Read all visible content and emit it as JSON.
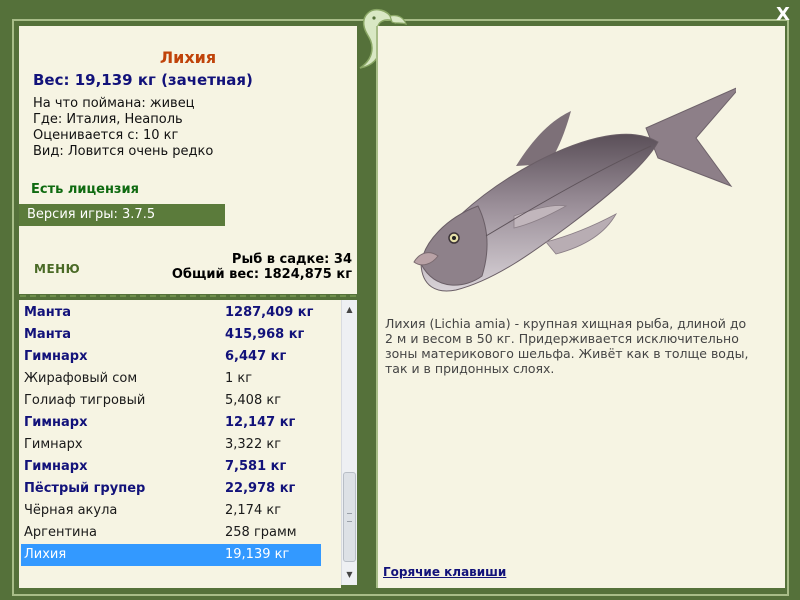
{
  "window": {
    "close_label": "X"
  },
  "fish": {
    "title": "Лихия",
    "weight_line": "Вес: 19,139 кг (зачетная)",
    "details": [
      "На что поймана: живец",
      "Где: Италия, Неаполь",
      "Оценивается с: 10 кг",
      "Вид: Ловится очень редко"
    ]
  },
  "license": "Есть лицензия",
  "version": "Версия игры: 3.7.5",
  "menu_label": "МЕНЮ",
  "stats": {
    "fish_in_keepnet": "Рыб в садке: 34",
    "total_weight": "Общий вес: 1824,875 кг"
  },
  "catch_list": [
    {
      "name": "Манта",
      "weight": "1287,409 кг",
      "trophy": true
    },
    {
      "name": "Манта",
      "weight": "415,968 кг",
      "trophy": true
    },
    {
      "name": "Гимнарх",
      "weight": "6,447 кг",
      "trophy": true
    },
    {
      "name": "Жирафовый сом",
      "weight": "1 кг",
      "trophy": false
    },
    {
      "name": "Голиаф тигровый",
      "weight": "5,408 кг",
      "trophy": false
    },
    {
      "name": "Гимнарх",
      "weight": "12,147 кг",
      "trophy": true
    },
    {
      "name": "Гимнарх",
      "weight": "3,322 кг",
      "trophy": false
    },
    {
      "name": "Гимнарх",
      "weight": "7,581 кг",
      "trophy": true
    },
    {
      "name": "Пёстрый групер",
      "weight": "22,978 кг",
      "trophy": true
    },
    {
      "name": "Чёрная акула",
      "weight": "2,174 кг",
      "trophy": false
    },
    {
      "name": "Аргентина",
      "weight": "258 грамм",
      "trophy": false
    },
    {
      "name": "Лихия",
      "weight": "19,139 кг",
      "trophy": false,
      "selected": true
    }
  ],
  "description": "Лихия (Lichia amia) - крупная хищная рыба, длиной до 2 м и весом в 50 кг. Придерживается исключительно зоны материкового шельфа. Живёт как в толще воды, так и в придонных слоях.",
  "hotkeys_label": "Горячие клавиши",
  "colors": {
    "frame": "#55713a",
    "panel": "#f6f4e3",
    "title": "#c0430a",
    "trophy_text": "#12127a",
    "selection": "#3399ff",
    "license": "#0f6a10"
  },
  "icons": {
    "logo": "fish-logo",
    "close": "close-icon",
    "fish_image": "lichia-fish"
  }
}
